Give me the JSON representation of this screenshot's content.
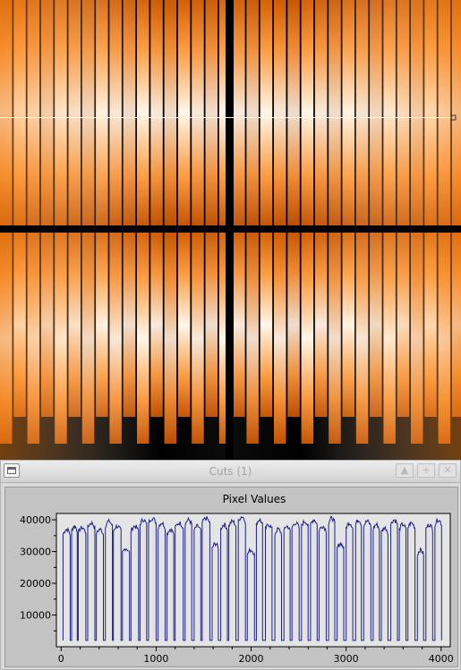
{
  "window": {
    "title": "Cuts (1)",
    "buttons": [
      "shade",
      "maximize",
      "close"
    ]
  },
  "colors": {
    "image_peak": "#fff3e6",
    "image_mid": "#ff9a3a",
    "image_dark": "#cf5a00",
    "plot_line": "#1a1f8a",
    "plot_background": "#e4e4e4",
    "plot_frame": "#c3c3c3"
  },
  "icons": {
    "window_menu": "window-menu-icon",
    "shade": "chevron-up-icon",
    "maximize": "plus-icon",
    "close": "close-icon"
  },
  "chart_data": {
    "type": "line",
    "title": "Pixel Values",
    "xlabel": "",
    "ylabel": "",
    "xlim": [
      -50,
      4096
    ],
    "ylim": [
      0,
      42000
    ],
    "x_ticks": [
      0,
      1000,
      2000,
      3000,
      4000
    ],
    "y_ticks": [
      10000,
      20000,
      30000,
      40000
    ],
    "x_tick_labels": [
      "0",
      "1000",
      "2000",
      "3000",
      "4000"
    ],
    "y_tick_labels": [
      "10000",
      "20000",
      "30000",
      "40000"
    ],
    "grid": false,
    "legend": "none",
    "series": [
      {
        "segment_starts": [
          20,
          110,
          180,
          280,
          370,
          465,
          550,
          645,
          735,
          830,
          920,
          1020,
          1115,
          1200,
          1305,
          1400,
          1485,
          1590,
          1680,
          1765,
          1865,
          1960,
          2055,
          2150,
          2250,
          2345,
          2430,
          2530,
          2625,
          2715,
          2815,
          2905,
          3000,
          3100,
          3185,
          3285,
          3370,
          3470,
          3560,
          3650,
          3750,
          3840,
          3935
        ],
        "segment_ends": [
          95,
          170,
          260,
          355,
          445,
          540,
          630,
          720,
          815,
          900,
          1000,
          1095,
          1185,
          1285,
          1375,
          1470,
          1565,
          1655,
          1750,
          1840,
          1940,
          2035,
          2120,
          2220,
          2320,
          2410,
          2505,
          2600,
          2695,
          2790,
          2880,
          2975,
          3070,
          3160,
          3260,
          3350,
          3440,
          3540,
          3630,
          3725,
          3815,
          3910,
          4005
        ],
        "segment_levels": [
          35500,
          36500,
          36000,
          37500,
          35500,
          38000,
          36500,
          29500,
          36500,
          38500,
          39000,
          37500,
          35500,
          37500,
          38500,
          36500,
          39000,
          31000,
          37000,
          38000,
          39500,
          29000,
          38500,
          37000,
          35500,
          36500,
          37500,
          38000,
          38500,
          36500,
          39000,
          31000,
          37500,
          38500,
          38000,
          37000,
          36000,
          38500,
          37000,
          37500,
          29000,
          37000,
          38500
        ],
        "floor": 2000
      }
    ]
  }
}
